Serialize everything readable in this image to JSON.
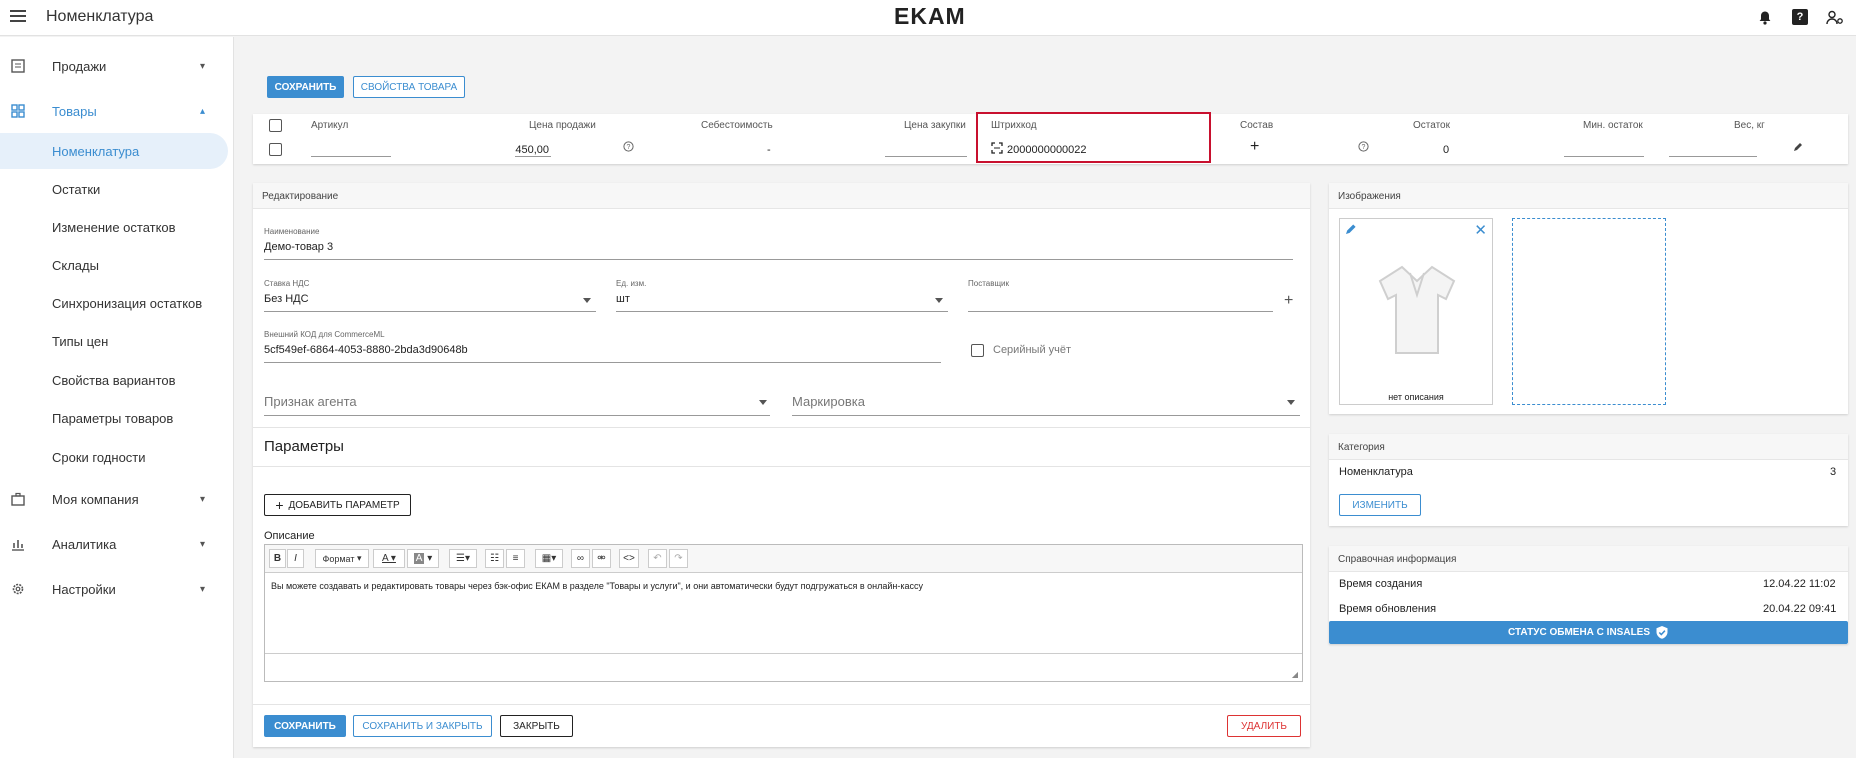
{
  "topbar": {
    "title": "Номенклатура",
    "logo": "EKAM"
  },
  "sidebar": {
    "groups": [
      {
        "label": "Продажи"
      },
      {
        "label": "Товары"
      },
      {
        "label": "Моя компания"
      },
      {
        "label": "Аналитика"
      },
      {
        "label": "Настройки"
      }
    ],
    "sub_items": [
      "Номенклатура",
      "Остатки",
      "Изменение остатков",
      "Склады",
      "Синхронизация остатков",
      "Типы цен",
      "Свойства вариантов",
      "Параметры товаров",
      "Сроки годности"
    ]
  },
  "toolbar": {
    "save_label": "Сохранить",
    "props_label": "Свойства товара"
  },
  "table": {
    "headers": [
      "Артикул",
      "Цена продажи",
      "Себестоимость",
      "Цена закупки",
      "Штрихкод",
      "Состав",
      "Остаток",
      "Мин. остаток",
      "Вес, кг"
    ],
    "row": {
      "price": "450,00",
      "cost": "-",
      "barcode": "2000000000022",
      "stock": "0"
    }
  },
  "edit": {
    "header": "Редактирование",
    "name_label": "Наименование",
    "name_value": "Демо-товар 3",
    "vat_label": "Ставка НДС",
    "vat_value": "Без НДС",
    "unit_label": "Ед. изм.",
    "unit_value": "шт",
    "supplier_label": "Поставщик",
    "extcode_label": "Внешний КОД для CommerceML",
    "extcode_value": "5cf549ef-6864-4053-8880-2bda3d90648b",
    "serial_label": "Серийный учёт",
    "agent_placeholder": "Признак агента",
    "marking_placeholder": "Маркировка",
    "params_title": "Параметры",
    "add_param_label": "Добавить параметр",
    "description_label": "Описание",
    "format_label": "Формат",
    "description_text": "Вы можете создавать и редактировать товары через бэк-офис ЕКАМ в разделе \"Товары и услуги\", и они автоматически будут подгружаться в онлайн-кассу",
    "save_label": "Сохранить",
    "save_close_label": "Сохранить и закрыть",
    "close_label": "Закрыть",
    "delete_label": "Удалить"
  },
  "images": {
    "header": "Изображения",
    "caption": "нет описания"
  },
  "category": {
    "header": "Категория",
    "name": "Номенклатура",
    "count": "3",
    "change_label": "Изменить"
  },
  "reference": {
    "header": "Справочная информация",
    "created_label": "Время создания",
    "created_value": "12.04.22 11:02",
    "updated_label": "Время обновления",
    "updated_value": "20.04.22 09:41",
    "insales_label": "Статус обмена с INSALES"
  },
  "colors": {
    "accent": "#3b8dd0",
    "danger": "#d33333",
    "highlight": "#c8102e"
  }
}
